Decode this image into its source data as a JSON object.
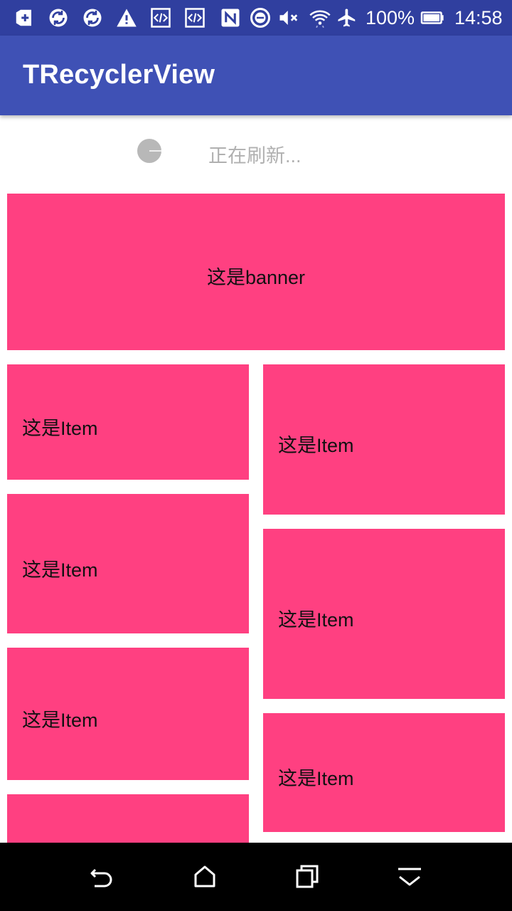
{
  "status_bar": {
    "icons": [
      "add-box-icon",
      "sync-icon",
      "sync-icon",
      "warning-icon",
      "code-icon",
      "code-icon",
      "nfc-icon",
      "do-not-disturb-icon",
      "volume-mute-icon",
      "wifi-icon",
      "airplane-icon",
      "battery-icon"
    ],
    "battery_percent": "100%",
    "time": "14:58"
  },
  "app_bar": {
    "title": "TRecyclerView"
  },
  "refresh": {
    "text": "正在刷新..."
  },
  "banner": {
    "label": "这是banner"
  },
  "items": {
    "left": [
      {
        "label": "这是Item"
      },
      {
        "label": "这是Item"
      },
      {
        "label": "这是Item"
      },
      {
        "label": ""
      }
    ],
    "right": [
      {
        "label": "这是Item"
      },
      {
        "label": "这是Item"
      },
      {
        "label": "这是Item"
      }
    ]
  },
  "nav_bar": {
    "buttons": [
      "back-icon",
      "home-icon",
      "recents-icon",
      "hide-keyboard-icon"
    ]
  },
  "colors": {
    "status_bar": "#303f9f",
    "app_bar": "#3f51b5",
    "card": "#ff4081",
    "nav_bar": "#000000"
  }
}
